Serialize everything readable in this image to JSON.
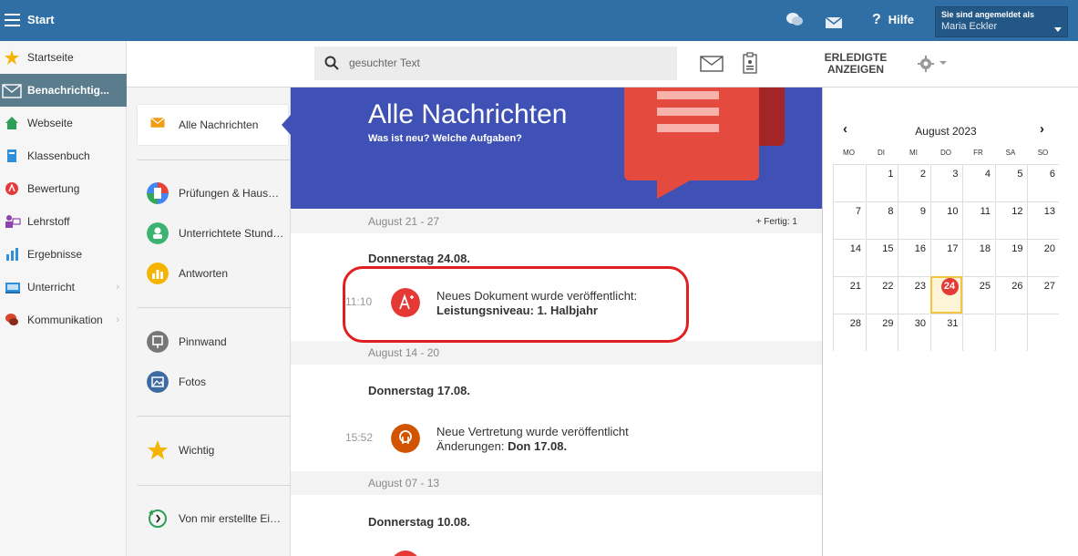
{
  "topbar": {
    "start_label": "Start",
    "help_mark": "?",
    "help_label": "Hilfe",
    "user_caption": "Sie sind angemeldet als",
    "user_name": "Maria Eckler"
  },
  "sidebar": {
    "items": [
      {
        "label": "Startseite",
        "icon": "star-icon",
        "color": "#f4b400"
      },
      {
        "label": "Benachrichtig...",
        "icon": "envelope-icon",
        "color": "#ffffff",
        "active": true
      },
      {
        "label": "Webseite",
        "icon": "house-icon",
        "color": "#2e9e58"
      },
      {
        "label": "Klassenbuch",
        "icon": "book-icon",
        "color": "#2f8fd8"
      },
      {
        "label": "Bewertung",
        "icon": "grade-icon",
        "color": "#e23b3b"
      },
      {
        "label": "Lehrstoff",
        "icon": "teacher-icon",
        "color": "#8e44ad"
      },
      {
        "label": "Ergebnisse",
        "icon": "barchart-icon",
        "color": "#2f8fd8"
      },
      {
        "label": "Unterricht",
        "icon": "classroom-icon",
        "color": "#2f8fd8"
      },
      {
        "label": "Kommunikation",
        "icon": "chat-icon",
        "color": "#d9452b"
      }
    ]
  },
  "toolbar": {
    "search_placeholder": "gesuchter Text",
    "done_line1": "ERLEDIGTE",
    "done_line2": "ANZEIGEN"
  },
  "filters": {
    "items": [
      {
        "label": "Alle Nachrichten",
        "icon": "envelope-icon"
      },
      {
        "label": "Prüfungen & Hausaufgaben",
        "icon": "exam-icon"
      },
      {
        "label": "Unterrichtete Stunden",
        "icon": "lesson-icon"
      },
      {
        "label": "Antworten",
        "icon": "answers-icon"
      },
      {
        "label": "Pinnwand",
        "icon": "board-icon"
      },
      {
        "label": "Fotos",
        "icon": "photo-icon"
      },
      {
        "label": "Wichtig",
        "icon": "star-icon"
      },
      {
        "label": "Von mir erstellte Einträge",
        "icon": "history-icon"
      }
    ]
  },
  "feed": {
    "banner_title": "Alle Nachrichten",
    "banner_subtitle": "Was ist neu? Welche Aufgaben?",
    "weeks": [
      {
        "range": "August 21 - 27",
        "done_count": "+ Fertig: 1",
        "day": "Donnerstag 24.08.",
        "time": "11:10",
        "line1": "Neues Dokument wurde veröffentlicht:",
        "line2_prefix": "",
        "line2_bold": "Leistungsniveau: 1. Halbjahr"
      },
      {
        "range": "August 14 - 20",
        "day": "Donnerstag 17.08.",
        "time": "15:52",
        "line1": "Neue Vertretung wurde veröffentlicht",
        "line2_prefix": "Änderungen: ",
        "line2_bold": "Don 17.08."
      },
      {
        "range": "August 07 - 13",
        "day": "Donnerstag 10.08."
      }
    ]
  },
  "calendar": {
    "title": "August 2023",
    "prev": "‹",
    "next": "›",
    "weekdays": [
      "MO",
      "DI",
      "MI",
      "DO",
      "FR",
      "SA",
      "SO"
    ],
    "weeks": [
      [
        "",
        "1",
        "2",
        "3",
        "4",
        "5",
        "6"
      ],
      [
        "7",
        "8",
        "9",
        "10",
        "11",
        "12",
        "13"
      ],
      [
        "14",
        "15",
        "16",
        "17",
        "18",
        "19",
        "20"
      ],
      [
        "21",
        "22",
        "23",
        "24",
        "25",
        "26",
        "27"
      ],
      [
        "28",
        "29",
        "30",
        "31",
        "",
        "",
        ""
      ]
    ],
    "today": "24"
  },
  "colors": {
    "topbar": "#2f6fa6",
    "banner": "#3f51b5",
    "highlight": "#e02020",
    "today_badge": "#e53935"
  }
}
